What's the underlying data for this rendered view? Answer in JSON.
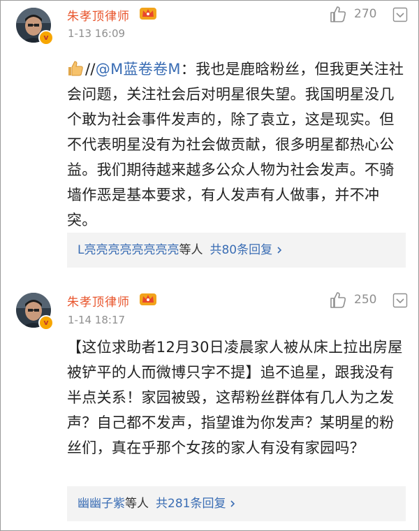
{
  "comments": [
    {
      "author": "朱孝顶律师",
      "time": "1-13 16:09",
      "likes": "270",
      "verified_badge": "v",
      "text_parts": {
        "prefix": "//",
        "mention": "@M蓝卷卷M",
        "rest": "：我也是鹿晗粉丝，但我更关注社会问题，关注社会后对明星很失望。我国明星没几个敢为社会事件发声的，除了袁立，这是现实。但不代表明星没有为社会做贡献，很多明星都热心公益。我们期待越来越多公众人物为社会发声。不骑墙作恶是基本要求，有人发声有人做事，并不冲突。"
      },
      "replies": {
        "users": "L亮亮亮亮亮亮亮亮",
        "mid": "等人",
        "count": "共80条回复"
      }
    },
    {
      "author": "朱孝顶律师",
      "time": "1-14 18:17",
      "likes": "250",
      "verified_badge": "v",
      "text": "【这位求助者12月30日凌晨家人被从床上拉出房屋被铲平的人而微博只字不提】追不追星，跟我没有半点关系！家园被毁，这帮粉丝群体有几人为之发声？自己都不发声，指望谁为你发声？某明星的粉丝们，真在乎那个女孩的家人有没有家园吗？",
      "replies": {
        "users": "幽幽子紫",
        "mid": "等人",
        "count": "共281条回复"
      }
    }
  ],
  "colors": {
    "author": "#e8542b",
    "link": "#3a6db4",
    "meta": "#8f8f8f",
    "reply_bg": "#f3f3f3"
  },
  "icons": [
    "avatar",
    "verified-badge",
    "crown-icon",
    "thumbs-up-icon",
    "chevron-down-icon",
    "thumbs-up-emoji-icon",
    "chevron-right-icon"
  ]
}
